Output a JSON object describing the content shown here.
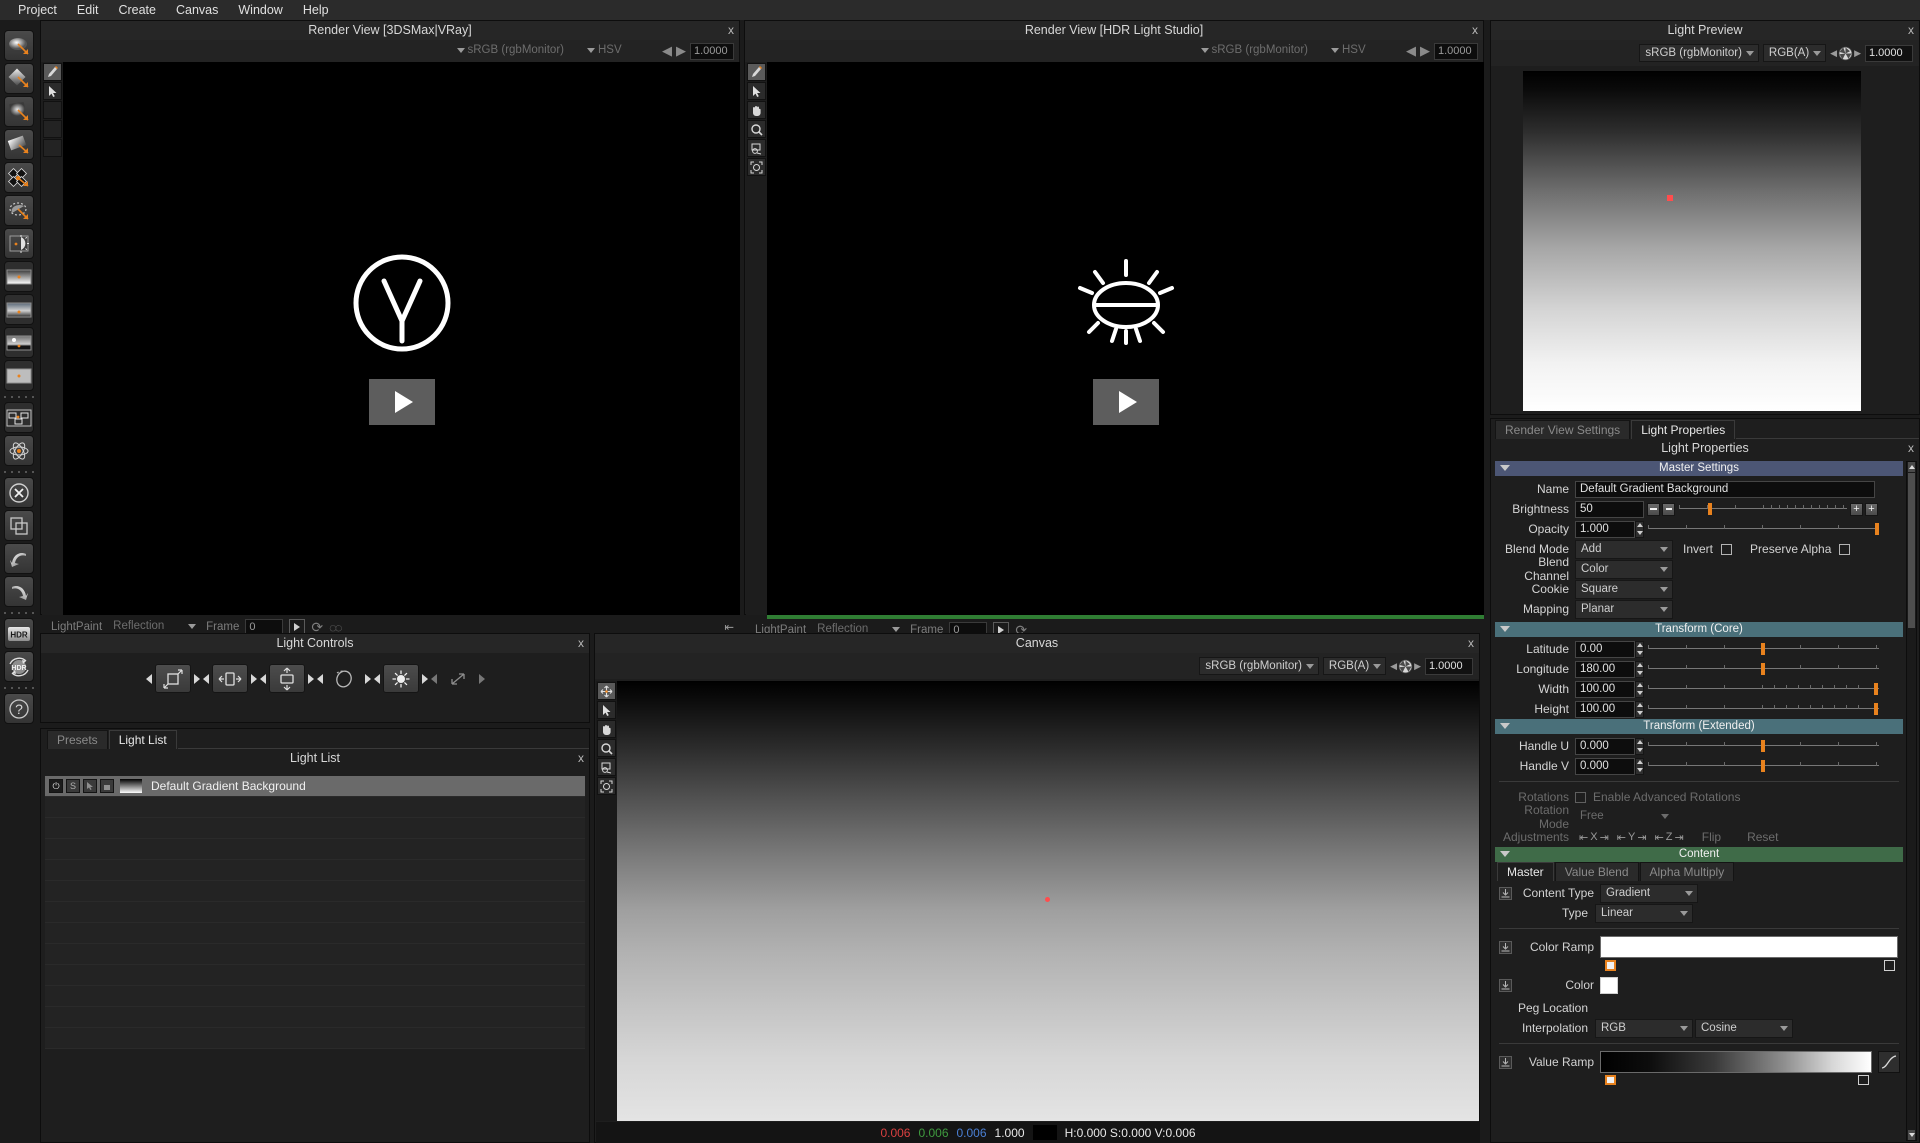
{
  "menu": {
    "items": [
      "Project",
      "Edit",
      "Create",
      "Canvas",
      "Window",
      "Help"
    ]
  },
  "left_toolbar": {
    "items": [
      {
        "name": "light-area-icon"
      },
      {
        "name": "light-diamond-icon"
      },
      {
        "name": "light-square-soft-icon"
      },
      {
        "name": "light-card-icon"
      },
      {
        "name": "light-multi-icon"
      },
      {
        "name": "light-disc-icon"
      },
      {
        "name": "light-procedural-icon"
      },
      {
        "name": "gradient-content-icon"
      },
      {
        "name": "image-content-icon"
      },
      {
        "name": "sky-content-icon"
      },
      {
        "name": "flat-content-icon"
      },
      {
        "name": "node-graph-icon"
      },
      {
        "name": "atom-icon"
      },
      {
        "name": "delete-light-icon"
      },
      {
        "name": "duplicate-icon"
      },
      {
        "name": "undo-icon"
      },
      {
        "name": "redo-icon"
      },
      {
        "name": "hdr-load-icon"
      },
      {
        "name": "hdr-refresh-icon"
      },
      {
        "name": "help-icon"
      }
    ]
  },
  "render_view_left": {
    "title": "Render View [3DSMax|VRay]",
    "close_label": "x",
    "colorspace": "sRGB (rgbMonitor)",
    "channel": "HSV",
    "exposure": "1.0000",
    "logo": "vray-logo-icon",
    "footer": {
      "lightpaint_label": "LightPaint",
      "mode": "Reflection",
      "frame_label": "Frame",
      "frame_value": "0"
    },
    "tools": [
      "brush-icon",
      "pointer-icon",
      "empty",
      "empty",
      "empty"
    ]
  },
  "render_view_right": {
    "title": "Render View [HDR Light Studio]",
    "close_label": "x",
    "colorspace": "sRGB (rgbMonitor)",
    "channel": "HSV",
    "exposure": "1.0000",
    "logo": "hdr-light-studio-sun-icon",
    "footer": {
      "lightpaint_label": "LightPaint",
      "mode": "Reflection",
      "frame_label": "Frame",
      "frame_value": "0"
    },
    "tools": [
      "brush-icon",
      "pointer-icon",
      "hand-icon",
      "zoom-icon",
      "fit-icon",
      "zoom-region-icon"
    ]
  },
  "light_preview": {
    "title": "Light Preview",
    "close_label": "x",
    "colorspace": "sRGB (rgbMonitor)",
    "channel": "RGB(A)",
    "exposure": "1.0000",
    "aperture_icon": "aperture-icon"
  },
  "light_controls": {
    "title": "Light Controls",
    "close_label": "x",
    "buttons": [
      {
        "name": "scale-control-icon",
        "enabled": true
      },
      {
        "name": "width-control-icon",
        "enabled": true
      },
      {
        "name": "height-control-icon",
        "enabled": true
      },
      {
        "name": "rotate-control-icon",
        "enabled": false
      },
      {
        "name": "brightness-control-icon",
        "enabled": true
      },
      {
        "name": "diagonal-scale-control-icon",
        "enabled": false
      }
    ]
  },
  "light_list": {
    "tabs": [
      {
        "label": "Presets",
        "active": false
      },
      {
        "label": "Light List",
        "active": true
      }
    ],
    "title": "Light List",
    "close_label": "x",
    "row_buttons": [
      "power-icon",
      "solo-icon",
      "select-icon",
      "lock-icon"
    ],
    "items": [
      {
        "name": "Default Gradient Background"
      }
    ],
    "empty_rows": 12
  },
  "canvas": {
    "title": "Canvas",
    "close_label": "x",
    "colorspace": "sRGB (rgbMonitor)",
    "channel": "RGB(A)",
    "exposure": "1.0000",
    "aperture_icon": "aperture-icon",
    "tools": [
      "move-icon",
      "pointer-icon",
      "hand-icon",
      "zoom-icon",
      "fit-icon",
      "zoom-region-icon"
    ],
    "status": {
      "r": "0.006",
      "g": "0.006",
      "b": "0.006",
      "a": "1.000",
      "hsv": "H:0.000 S:0.000 V:0.006"
    }
  },
  "properties": {
    "tabs": [
      {
        "label": "Render View Settings",
        "active": false
      },
      {
        "label": "Light Properties",
        "active": true
      }
    ],
    "title": "Light Properties",
    "close_label": "x",
    "sections": {
      "master": {
        "header": "Master Settings",
        "name_label": "Name",
        "name_value": "Default Gradient Background",
        "brightness_label": "Brightness",
        "brightness_value": "50",
        "opacity_label": "Opacity",
        "opacity_value": "1.000",
        "blend_mode_label": "Blend Mode",
        "blend_mode_value": "Add",
        "invert_label": "Invert",
        "preserve_alpha_label": "Preserve Alpha",
        "blend_channel_label": "Blend Channel",
        "blend_channel_value": "Color",
        "cookie_label": "Cookie",
        "cookie_value": "Square",
        "mapping_label": "Mapping",
        "mapping_value": "Planar"
      },
      "transform_core": {
        "header": "Transform (Core)",
        "latitude_label": "Latitude",
        "latitude_value": "0.00",
        "longitude_label": "Longitude",
        "longitude_value": "180.00",
        "width_label": "Width",
        "width_value": "100.00",
        "height_label": "Height",
        "height_value": "100.00"
      },
      "transform_extended": {
        "header": "Transform (Extended)",
        "handle_u_label": "Handle U",
        "handle_u_value": "0.000",
        "handle_v_label": "Handle V",
        "handle_v_value": "0.000",
        "rotations_label": "Rotations",
        "enable_adv_rotations_label": "Enable Advanced Rotations",
        "rotation_mode_label": "Rotation Mode",
        "rotation_mode_value": "Free",
        "adjustments_label": "Adjustments",
        "axis_x": "X",
        "axis_y": "Y",
        "axis_z": "Z",
        "flip_label": "Flip",
        "reset_label": "Reset"
      },
      "content": {
        "header": "Content",
        "tabs": [
          {
            "label": "Master",
            "active": true
          },
          {
            "label": "Value Blend",
            "active": false
          },
          {
            "label": "Alpha Multiply",
            "active": false
          }
        ],
        "content_type_label": "Content Type",
        "content_type_value": "Gradient",
        "type_label": "Type",
        "type_value": "Linear",
        "color_ramp_label": "Color Ramp",
        "color_label": "Color",
        "color_value": "#ffffff",
        "peg_location_label": "Peg Location",
        "interpolation_label": "Interpolation",
        "interpolation_space": "RGB",
        "interpolation_curve": "Cosine",
        "value_ramp_label": "Value Ramp"
      }
    }
  },
  "colors": {
    "accent_orange": "#e8821e",
    "section_blue": "#4c5675",
    "section_teal": "#4a707a",
    "section_green": "#3f6b48",
    "marker_red": "#ff4d4d",
    "panel_bg": "#1e1e1e"
  }
}
